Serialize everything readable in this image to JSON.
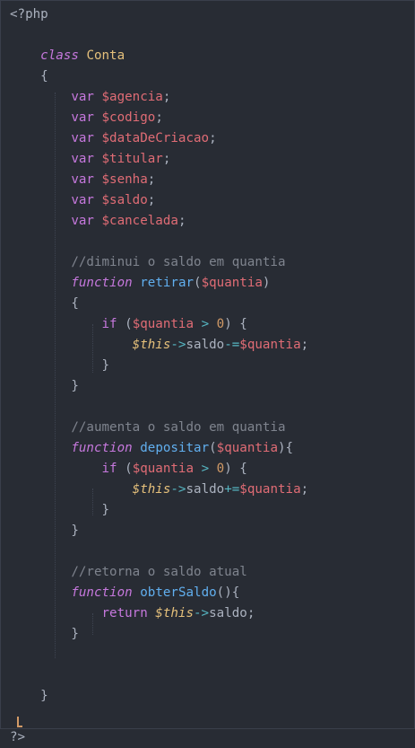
{
  "editor": {
    "lines": [
      {
        "tokens": [
          {
            "t": "<?php",
            "c": "t"
          }
        ]
      },
      {
        "tokens": []
      },
      {
        "tokens": [
          {
            "t": "    ",
            "c": "t"
          },
          {
            "t": "class",
            "c": "kw-it"
          },
          {
            "t": " ",
            "c": "t"
          },
          {
            "t": "Conta",
            "c": "cls"
          }
        ]
      },
      {
        "tokens": [
          {
            "t": "    {",
            "c": "t"
          }
        ]
      },
      {
        "tokens": [
          {
            "t": "        ",
            "c": "t"
          },
          {
            "t": "var",
            "c": "kw"
          },
          {
            "t": " ",
            "c": "t"
          },
          {
            "t": "$agencia",
            "c": "var"
          },
          {
            "t": ";",
            "c": "t"
          }
        ]
      },
      {
        "tokens": [
          {
            "t": "        ",
            "c": "t"
          },
          {
            "t": "var",
            "c": "kw"
          },
          {
            "t": " ",
            "c": "t"
          },
          {
            "t": "$codigo",
            "c": "var"
          },
          {
            "t": ";",
            "c": "t"
          }
        ]
      },
      {
        "tokens": [
          {
            "t": "        ",
            "c": "t"
          },
          {
            "t": "var",
            "c": "kw"
          },
          {
            "t": " ",
            "c": "t"
          },
          {
            "t": "$dataDeCriacao",
            "c": "var"
          },
          {
            "t": ";",
            "c": "t"
          }
        ]
      },
      {
        "tokens": [
          {
            "t": "        ",
            "c": "t"
          },
          {
            "t": "var",
            "c": "kw"
          },
          {
            "t": " ",
            "c": "t"
          },
          {
            "t": "$titular",
            "c": "var"
          },
          {
            "t": ";",
            "c": "t"
          }
        ]
      },
      {
        "tokens": [
          {
            "t": "        ",
            "c": "t"
          },
          {
            "t": "var",
            "c": "kw"
          },
          {
            "t": " ",
            "c": "t"
          },
          {
            "t": "$senha",
            "c": "var"
          },
          {
            "t": ";",
            "c": "t"
          }
        ]
      },
      {
        "tokens": [
          {
            "t": "        ",
            "c": "t"
          },
          {
            "t": "var",
            "c": "kw"
          },
          {
            "t": " ",
            "c": "t"
          },
          {
            "t": "$saldo",
            "c": "var"
          },
          {
            "t": ";",
            "c": "t"
          }
        ]
      },
      {
        "tokens": [
          {
            "t": "        ",
            "c": "t"
          },
          {
            "t": "var",
            "c": "kw"
          },
          {
            "t": " ",
            "c": "t"
          },
          {
            "t": "$cancelada",
            "c": "var"
          },
          {
            "t": ";",
            "c": "t"
          }
        ]
      },
      {
        "tokens": []
      },
      {
        "tokens": [
          {
            "t": "        ",
            "c": "t"
          },
          {
            "t": "//diminui o saldo em quantia",
            "c": "cmt"
          }
        ]
      },
      {
        "tokens": [
          {
            "t": "        ",
            "c": "t"
          },
          {
            "t": "function",
            "c": "kw-it"
          },
          {
            "t": " ",
            "c": "t"
          },
          {
            "t": "retirar",
            "c": "fn"
          },
          {
            "t": "(",
            "c": "t"
          },
          {
            "t": "$quantia",
            "c": "param"
          },
          {
            "t": ")",
            "c": "t"
          }
        ]
      },
      {
        "tokens": [
          {
            "t": "        {",
            "c": "t"
          }
        ]
      },
      {
        "tokens": [
          {
            "t": "            ",
            "c": "t"
          },
          {
            "t": "if",
            "c": "kw"
          },
          {
            "t": " (",
            "c": "t"
          },
          {
            "t": "$quantia",
            "c": "var"
          },
          {
            "t": " ",
            "c": "t"
          },
          {
            "t": ">",
            "c": "op"
          },
          {
            "t": " ",
            "c": "t"
          },
          {
            "t": "0",
            "c": "num"
          },
          {
            "t": ") {",
            "c": "t"
          }
        ]
      },
      {
        "tokens": [
          {
            "t": "                ",
            "c": "t"
          },
          {
            "t": "$this",
            "c": "this-it"
          },
          {
            "t": "->",
            "c": "op"
          },
          {
            "t": "saldo",
            "c": "t"
          },
          {
            "t": "-=",
            "c": "op"
          },
          {
            "t": "$quantia",
            "c": "var"
          },
          {
            "t": ";",
            "c": "t"
          }
        ]
      },
      {
        "tokens": [
          {
            "t": "            }",
            "c": "t"
          }
        ]
      },
      {
        "tokens": [
          {
            "t": "        }",
            "c": "t"
          }
        ]
      },
      {
        "tokens": []
      },
      {
        "tokens": [
          {
            "t": "        ",
            "c": "t"
          },
          {
            "t": "//aumenta o saldo em quantia",
            "c": "cmt"
          }
        ]
      },
      {
        "tokens": [
          {
            "t": "        ",
            "c": "t"
          },
          {
            "t": "function",
            "c": "kw-it"
          },
          {
            "t": " ",
            "c": "t"
          },
          {
            "t": "depositar",
            "c": "fn"
          },
          {
            "t": "(",
            "c": "t"
          },
          {
            "t": "$quantia",
            "c": "param"
          },
          {
            "t": "){",
            "c": "t"
          }
        ]
      },
      {
        "tokens": [
          {
            "t": "            ",
            "c": "t"
          },
          {
            "t": "if",
            "c": "kw"
          },
          {
            "t": " (",
            "c": "t"
          },
          {
            "t": "$quantia",
            "c": "var"
          },
          {
            "t": " ",
            "c": "t"
          },
          {
            "t": ">",
            "c": "op"
          },
          {
            "t": " ",
            "c": "t"
          },
          {
            "t": "0",
            "c": "num"
          },
          {
            "t": ") {",
            "c": "t"
          }
        ]
      },
      {
        "tokens": [
          {
            "t": "                ",
            "c": "t"
          },
          {
            "t": "$this",
            "c": "this-it"
          },
          {
            "t": "->",
            "c": "op"
          },
          {
            "t": "saldo",
            "c": "t"
          },
          {
            "t": "+=",
            "c": "op"
          },
          {
            "t": "$quantia",
            "c": "var"
          },
          {
            "t": ";",
            "c": "t"
          }
        ]
      },
      {
        "tokens": [
          {
            "t": "            }",
            "c": "t"
          }
        ]
      },
      {
        "tokens": [
          {
            "t": "        }",
            "c": "t"
          }
        ]
      },
      {
        "tokens": []
      },
      {
        "tokens": [
          {
            "t": "        ",
            "c": "t"
          },
          {
            "t": "//retorna o saldo atual",
            "c": "cmt"
          }
        ]
      },
      {
        "tokens": [
          {
            "t": "        ",
            "c": "t"
          },
          {
            "t": "function",
            "c": "kw-it"
          },
          {
            "t": " ",
            "c": "t"
          },
          {
            "t": "obterSaldo",
            "c": "fn"
          },
          {
            "t": "(){",
            "c": "t"
          }
        ]
      },
      {
        "tokens": [
          {
            "t": "            ",
            "c": "t"
          },
          {
            "t": "return",
            "c": "kw"
          },
          {
            "t": " ",
            "c": "t"
          },
          {
            "t": "$this",
            "c": "this-it"
          },
          {
            "t": "->",
            "c": "op"
          },
          {
            "t": "saldo",
            "c": "t"
          },
          {
            "t": ";",
            "c": "t"
          }
        ]
      },
      {
        "tokens": [
          {
            "t": "        }",
            "c": "t"
          }
        ]
      },
      {
        "tokens": []
      },
      {
        "tokens": []
      },
      {
        "tokens": [
          {
            "t": "    }",
            "c": "t"
          }
        ]
      },
      {
        "tokens": []
      },
      {
        "tokens": [
          {
            "t": "?>",
            "c": "t"
          }
        ]
      }
    ]
  },
  "theme": {
    "background": "#282c34",
    "keyword": "#c678dd",
    "class_name": "#e5c07b",
    "variable": "#e06c75",
    "function_name": "#61afef",
    "number": "#d19a66",
    "operator": "#56b6c2",
    "comment": "#7f848e",
    "text": "#abb2bf"
  }
}
